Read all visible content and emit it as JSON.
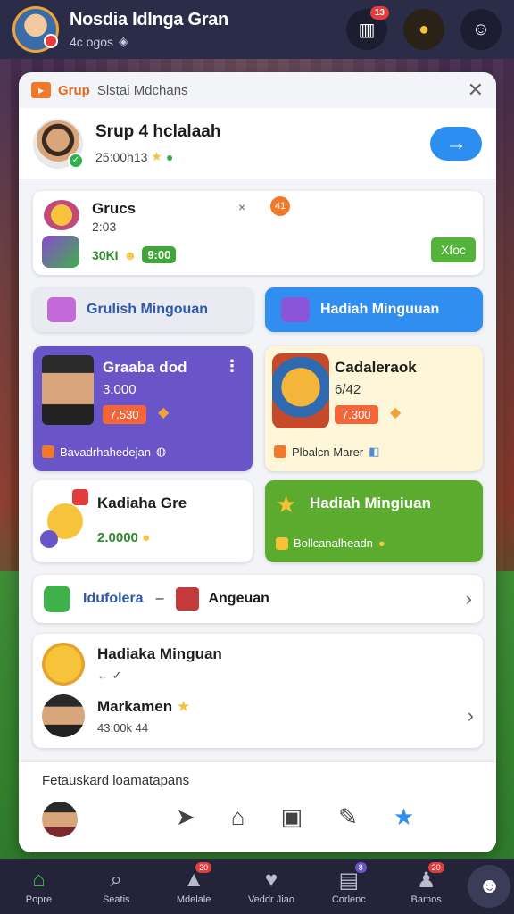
{
  "topbar": {
    "title": "Nosdia Idlnga Gran",
    "subtitle": "4c ogos",
    "badge_count": "13"
  },
  "panel": {
    "brand": "Grup",
    "heading": "Slstai Mdchans",
    "profile": {
      "name": "Srup 4 hclalaah",
      "meta": "25:00h13"
    },
    "group_card": {
      "title": "Grucs",
      "subtitle": "2:03",
      "value": "30KI",
      "pill": "9:00",
      "sep": "×",
      "ring": "41",
      "button": "Xfoc"
    },
    "tab_left": "Grulish Mingouan",
    "tab_right": "Hadiah Minguuan",
    "tile_purple": {
      "title": "Graaba dod",
      "subtitle": "3.000",
      "pill": "7.530",
      "footer": "Bavadrhahedejan"
    },
    "tile_yellow": {
      "title": "Cadaleraok",
      "subtitle": "6/42",
      "pill": "7.300",
      "footer": "Plbalcn Marer"
    },
    "tile_white": {
      "title": "Kadiaha Gre",
      "value": "2.0000"
    },
    "tile_green": {
      "title": "Hadiah Mingiuan",
      "footer": "Bollcanalheadn"
    },
    "link_row": {
      "left_label": "Idufolera",
      "dash": "–",
      "right_label": "Angeuan"
    },
    "list": [
      {
        "title": "Hadiaka Minguan",
        "meta": "← ✓"
      },
      {
        "title": "Markamen",
        "meta": "43:00k 44"
      }
    ],
    "share": {
      "title": "Fetauskard loamatapans"
    }
  },
  "bottom_nav": [
    {
      "label": "Popre",
      "badge": ""
    },
    {
      "label": "Seatis",
      "badge": ""
    },
    {
      "label": "Mdelale",
      "badge": "20"
    },
    {
      "label": "Veddr Jiao",
      "badge": ""
    },
    {
      "label": "Corlenc",
      "badge": "8"
    },
    {
      "label": "Bamos",
      "badge": "20"
    }
  ],
  "colors": {
    "accent_blue": "#2f8ef0",
    "accent_green": "#5bab2e",
    "accent_purple": "#6a55c8",
    "accent_orange": "#f07a2a"
  },
  "icons": [
    "search-icon",
    "home-icon",
    "gear-icon",
    "close-icon",
    "arrow-right-icon",
    "star-icon",
    "chevron-right-icon",
    "share-icon"
  ]
}
